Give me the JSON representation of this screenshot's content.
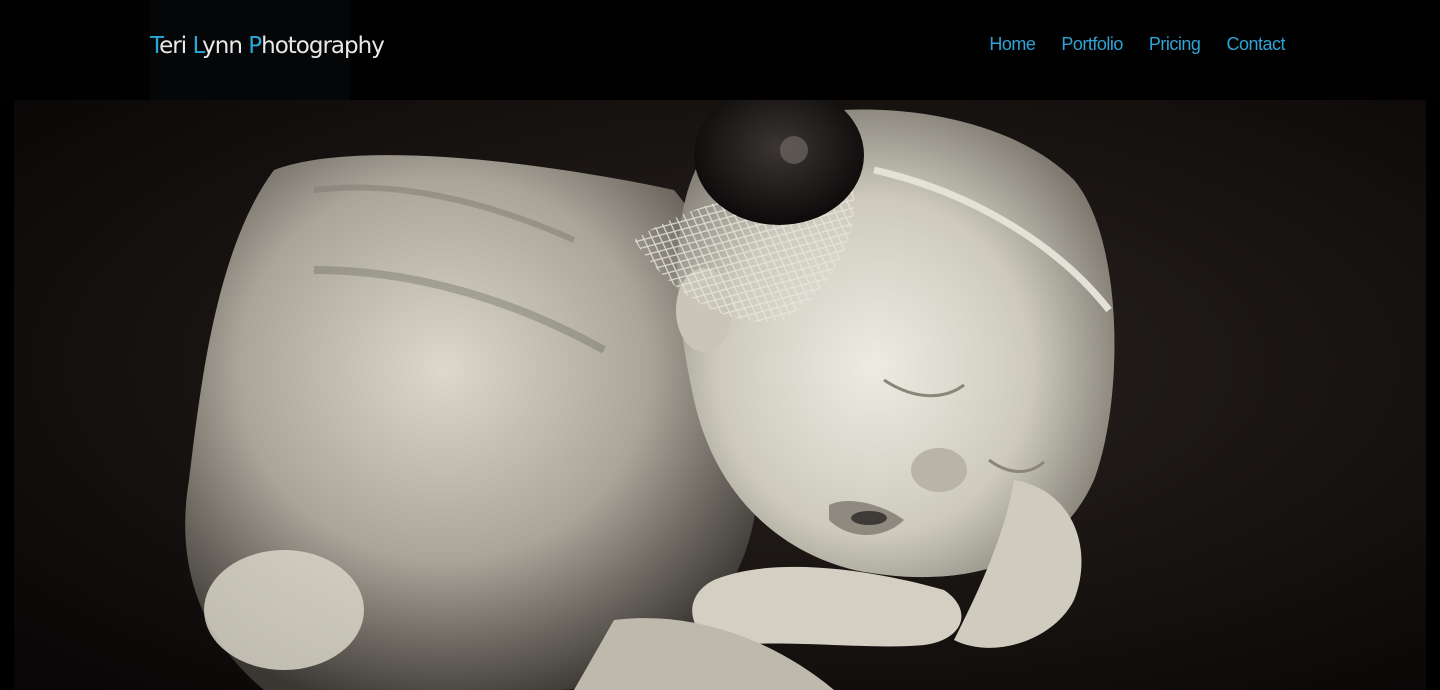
{
  "site": {
    "logo": {
      "words": [
        {
          "cap": "T",
          "rest": "eri "
        },
        {
          "cap": "L",
          "rest": "ynn "
        },
        {
          "cap": "P",
          "rest": "hotography"
        }
      ]
    }
  },
  "nav": {
    "items": [
      {
        "label": "Home"
      },
      {
        "label": "Portfolio"
      },
      {
        "label": "Pricing"
      },
      {
        "label": "Contact"
      }
    ]
  },
  "colors": {
    "accent": "#2ea3d5",
    "header_bg": "#010101",
    "logo_text": "#e9e9e9"
  },
  "hero": {
    "image_icon": "sleeping-newborn-photo"
  }
}
